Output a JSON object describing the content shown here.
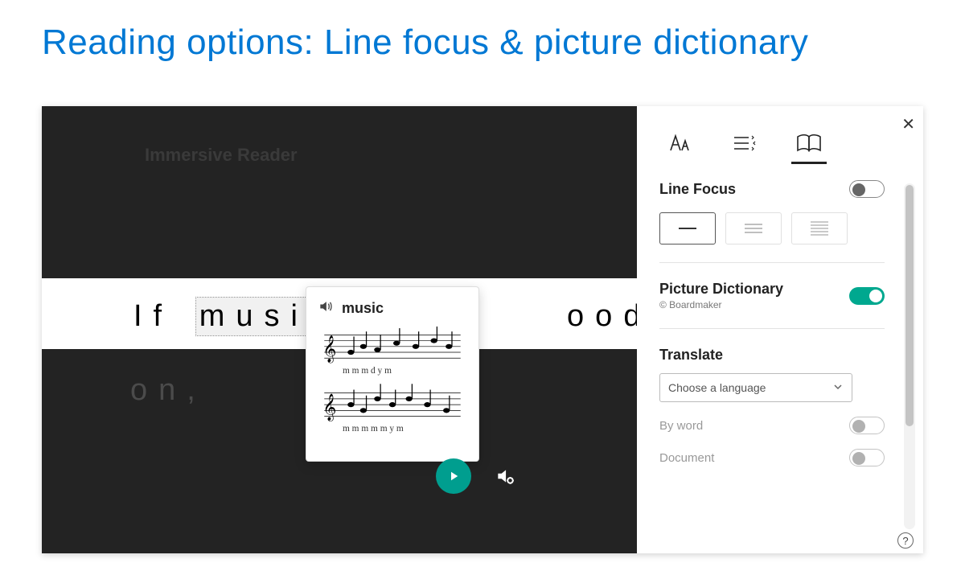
{
  "page": {
    "title": "Reading options: Line focus & picture dictionary"
  },
  "reader": {
    "mode_label": "Immersive Reader",
    "line1_before": "If",
    "line1_highlight": "music",
    "line1_after": "ood of lo",
    "line2": "on,"
  },
  "popup": {
    "word": "music"
  },
  "panel": {
    "line_focus_label": "Line Focus",
    "picture_dict_label": "Picture Dictionary",
    "picture_dict_credit": "© Boardmaker",
    "translate_label": "Translate",
    "translate_placeholder": "Choose a language",
    "by_word_label": "By word",
    "document_label": "Document"
  },
  "state": {
    "line_focus_on": false,
    "picture_dictionary_on": true,
    "by_word_enabled": false,
    "document_enabled": false
  },
  "colors": {
    "accent": "#0078d4",
    "teal": "#00a88f"
  }
}
